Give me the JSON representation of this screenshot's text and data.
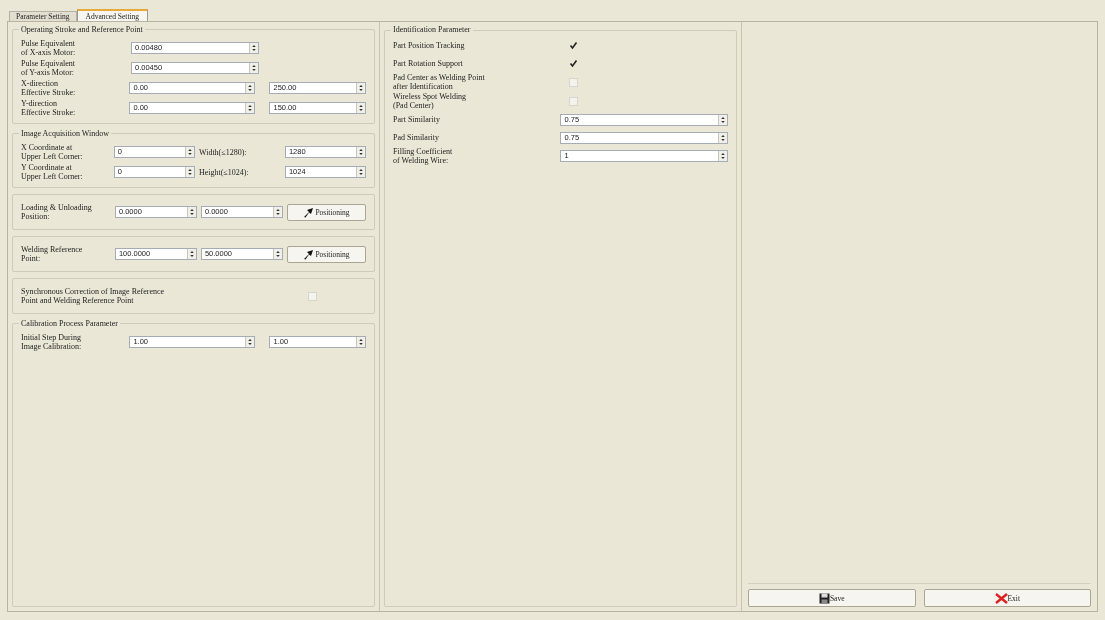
{
  "tabs": [
    {
      "label": "Parameter Setting",
      "selected": false
    },
    {
      "label": "Advanced Setting",
      "selected": true
    }
  ],
  "left_groups": [
    {
      "title": "Operating Stroke and Reference Point",
      "rows": [
        {
          "label": "Pulse Equivalent\nof X-axis Motor:",
          "items": [
            {
              "kind": "field",
              "value": "0.00480"
            }
          ]
        },
        {
          "label": "Pulse Equivalent\nof Y-axis Motor:",
          "items": [
            {
              "kind": "field",
              "value": "0.00450"
            }
          ]
        },
        {
          "label": "X-direction\nEffective Stroke:",
          "items": [
            {
              "kind": "field",
              "value": "0.00"
            },
            {
              "kind": "field",
              "value": "250.00"
            }
          ]
        },
        {
          "label": "Y-direction\nEffective Stroke:",
          "items": [
            {
              "kind": "field",
              "value": "0.00"
            },
            {
              "kind": "field",
              "value": "150.00"
            }
          ]
        }
      ]
    },
    {
      "title": "Image Acquisition Window",
      "rows": [
        {
          "label": "X Coordinate at\nUpper Left Corner:",
          "items": [
            {
              "kind": "field",
              "value": "0"
            },
            {
              "kind": "text",
              "text": "Width(≤1280):"
            },
            {
              "kind": "field",
              "value": "1280"
            }
          ]
        },
        {
          "label": "Y Coordinate at\nUpper Left Corner:",
          "items": [
            {
              "kind": "field",
              "value": "0"
            },
            {
              "kind": "text",
              "text": "Height(≤1024):"
            },
            {
              "kind": "field",
              "value": "1024"
            }
          ]
        }
      ]
    },
    {
      "rows": [
        {
          "label": "Loading & Unloading\nPosition:",
          "items": [
            {
              "kind": "field",
              "value": "0.0000"
            },
            {
              "kind": "field",
              "value": "0.0000"
            },
            {
              "kind": "button",
              "label": "Positioning"
            }
          ]
        }
      ]
    },
    {
      "rows": [
        {
          "label": "Welding Reference\nPoint:",
          "items": [
            {
              "kind": "field",
              "value": "100.0000"
            },
            {
              "kind": "field",
              "value": "50.0000"
            },
            {
              "kind": "button",
              "label": "Positioning"
            }
          ]
        }
      ]
    },
    {
      "rows": [
        {
          "label": "Synchronous Correction of Image Reference\nPoint and Welding Reference Point",
          "items": [
            {
              "kind": "checkbox",
              "checked": false
            }
          ]
        }
      ]
    },
    {
      "title": "Calibration Process Parameter",
      "rows": [
        {
          "label": "Initial Step During\nImage Calibration:",
          "items": [
            {
              "kind": "field",
              "value": "1.00"
            },
            {
              "kind": "field",
              "value": "1.00"
            }
          ]
        }
      ]
    }
  ],
  "identification": {
    "title": "Identification Parameter",
    "rows": [
      {
        "label": "Part Position Tracking",
        "kind": "checkbox",
        "checked": true
      },
      {
        "label": "Part Rotation Support",
        "kind": "checkbox",
        "checked": true
      },
      {
        "label": "Pad Center as Welding Point\nafter Identification",
        "kind": "checkbox",
        "checked": false
      },
      {
        "label": "Wireless Spot Welding\n(Pad Center)",
        "kind": "checkbox",
        "checked": false
      },
      {
        "label": "Part Similarity",
        "kind": "field",
        "value": "0.75"
      },
      {
        "label": "Pad Similarity",
        "kind": "field",
        "value": "0.75"
      },
      {
        "label": "Filling Coefficient\nof Welding Wire:",
        "kind": "field",
        "value": "1"
      }
    ]
  },
  "buttons": [
    {
      "label": "Save",
      "kind": "save"
    },
    {
      "label": "Exit",
      "kind": "exit"
    }
  ]
}
